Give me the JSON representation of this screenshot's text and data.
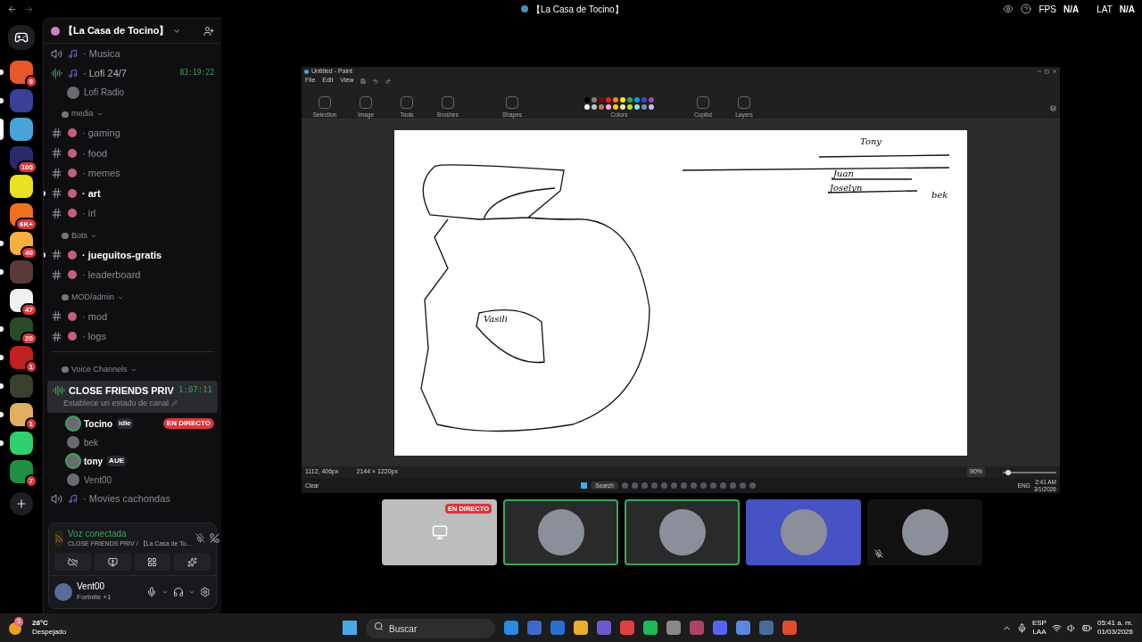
{
  "top_bar": {
    "title": "【La Casa de Tocino】",
    "fps_label": "FPS",
    "fps_value": "N/A",
    "lat_label": "LAT",
    "lat_value": "N/A"
  },
  "servers": [
    {
      "color": "#e8572a",
      "badge": "9",
      "unread": true,
      "selected": false
    },
    {
      "color": "#3a3f9a",
      "unread": true,
      "selected": false
    },
    {
      "color": "#4aa3d8",
      "unread": false,
      "selected": true
    },
    {
      "color": "#2a2a6a",
      "badge": "105",
      "unread": false,
      "selected": false
    },
    {
      "color": "#e8e020",
      "unread": false,
      "selected": false
    },
    {
      "color": "#f07020",
      "badge": "6K+",
      "unread": false,
      "selected": false
    },
    {
      "color": "#f5b040",
      "badge": "40",
      "unread": true,
      "selected": false
    },
    {
      "color": "#5a3a3a",
      "unread": true,
      "selected": false
    },
    {
      "color": "#f0f0f0",
      "badge": "47",
      "unread": false,
      "selected": false
    },
    {
      "color": "#2a4a2a",
      "badge": "20",
      "unread": true,
      "selected": false
    },
    {
      "color": "#c02020",
      "badge": "1",
      "unread": true,
      "selected": false
    },
    {
      "color": "#3a4030",
      "unread": true,
      "selected": false
    },
    {
      "color": "#e0b060",
      "badge": "1",
      "unread": true,
      "selected": false
    },
    {
      "color": "#30d070",
      "unread": true,
      "selected": false
    },
    {
      "color": "#209040",
      "badge": "7",
      "unread": false,
      "selected": false
    }
  ],
  "server_header": {
    "name": "【La Casa de Tocino】"
  },
  "channels": [
    {
      "kind": "voice",
      "name": "· Musica",
      "active": false
    },
    {
      "kind": "voice",
      "name": "· Lofi 24/7",
      "active": true,
      "timer": "83:19:22"
    },
    {
      "kind": "member",
      "name": "Lofi Radio",
      "speaking": false
    },
    {
      "kind": "category",
      "name": "media"
    },
    {
      "kind": "text",
      "name": "· gaming",
      "unread": false
    },
    {
      "kind": "text",
      "name": "· food",
      "unread": false
    },
    {
      "kind": "text",
      "name": "· memes",
      "unread": false
    },
    {
      "kind": "text",
      "name": "· art",
      "unread": true
    },
    {
      "kind": "text",
      "name": "· irl",
      "unread": false
    },
    {
      "kind": "category",
      "name": "Bots"
    },
    {
      "kind": "text",
      "name": "· jueguitos-gratis",
      "unread": true
    },
    {
      "kind": "text",
      "name": "· leaderboard",
      "unread": false
    },
    {
      "kind": "category",
      "name": "MOD/admin"
    },
    {
      "kind": "text",
      "name": "· mod",
      "unread": false
    },
    {
      "kind": "text",
      "name": "· logs",
      "unread": false
    },
    {
      "kind": "divider"
    },
    {
      "kind": "category",
      "name": "Voice Channels"
    },
    {
      "kind": "voice",
      "name": "CLOSE FRIENDS PRIV",
      "active": true,
      "selected": true,
      "timer": "1:07:11",
      "status": "Establece un estado de canal"
    },
    {
      "kind": "member",
      "name": "Tocino",
      "speaking": true,
      "tag": "idle",
      "live": "EN DIRECTO"
    },
    {
      "kind": "member",
      "name": "bek",
      "speaking": false
    },
    {
      "kind": "member",
      "name": "tony",
      "speaking": true,
      "tag": "AUE"
    },
    {
      "kind": "member",
      "name": "Vent00",
      "speaking": false
    },
    {
      "kind": "voice",
      "name": "· Movies cachondas",
      "active": false
    }
  ],
  "voice_panel": {
    "status": "Voz conectada",
    "location": "CLOSE FRIENDS PRIV /  【La Casa de To..."
  },
  "user": {
    "name": "Vent00",
    "activity": "Fortnite +1"
  },
  "paint": {
    "title": "Untitled - Paint",
    "menus": [
      "File",
      "Edit",
      "View"
    ],
    "groups": [
      "Selection",
      "Image",
      "Tools",
      "Brushes",
      "Shapes",
      "Colors",
      "Copilot",
      "Layers"
    ],
    "palette": [
      {
        "color": "#000000"
      },
      {
        "color": "#7f7f7f"
      },
      {
        "color": "#880015"
      },
      {
        "color": "#ed1c24"
      },
      {
        "color": "#ff7f27"
      },
      {
        "color": "#fff200"
      },
      {
        "color": "#22b14c"
      },
      {
        "color": "#00a2e8"
      },
      {
        "color": "#3f48cc"
      },
      {
        "color": "#a349a4"
      },
      {
        "color": "#ffffff"
      },
      {
        "color": "#c3c3c3"
      },
      {
        "color": "#b97a57"
      },
      {
        "color": "#ffaec9"
      },
      {
        "color": "#ffc90e"
      },
      {
        "color": "#efe4b0"
      },
      {
        "color": "#b5e61d"
      },
      {
        "color": "#99d9ea"
      },
      {
        "color": "#7092be"
      },
      {
        "color": "#c8bfe7"
      }
    ],
    "canvas_labels": [
      {
        "text": "Tony"
      },
      {
        "text": "Juan"
      },
      {
        "text": "Joselyn"
      },
      {
        "text": "bek"
      },
      {
        "text": "Vasili"
      }
    ],
    "cursor": "1112, 406px",
    "size": "2144 × 1220px",
    "zoom": "90%",
    "zoom_slider": {
      "level": 0.1
    },
    "taskbar": {
      "weather": "Clear",
      "search": "Search",
      "lang": "ENG",
      "time": "2:41 AM",
      "date": "3/1/2026"
    }
  },
  "tiles": [
    {
      "kind": "stream",
      "live": "EN DIRECTO",
      "speaking": false
    },
    {
      "kind": "avatar",
      "speaking": true,
      "color": "#2a2a2a"
    },
    {
      "kind": "avatar",
      "speaking": true,
      "color": "#2a2a2a"
    },
    {
      "kind": "avatar",
      "speaking": false,
      "color": "#4752c4"
    },
    {
      "kind": "avatar",
      "speaking": false,
      "muted": true,
      "color": "#111111"
    }
  ],
  "weather": {
    "badge": "3",
    "temp": "28°C",
    "desc": "Despejado"
  },
  "taskbar": {
    "search_placeholder": "Buscar",
    "lang": "ESP",
    "region": "LAA",
    "time": "05:41 a. m.",
    "date": "01/03/2026"
  }
}
